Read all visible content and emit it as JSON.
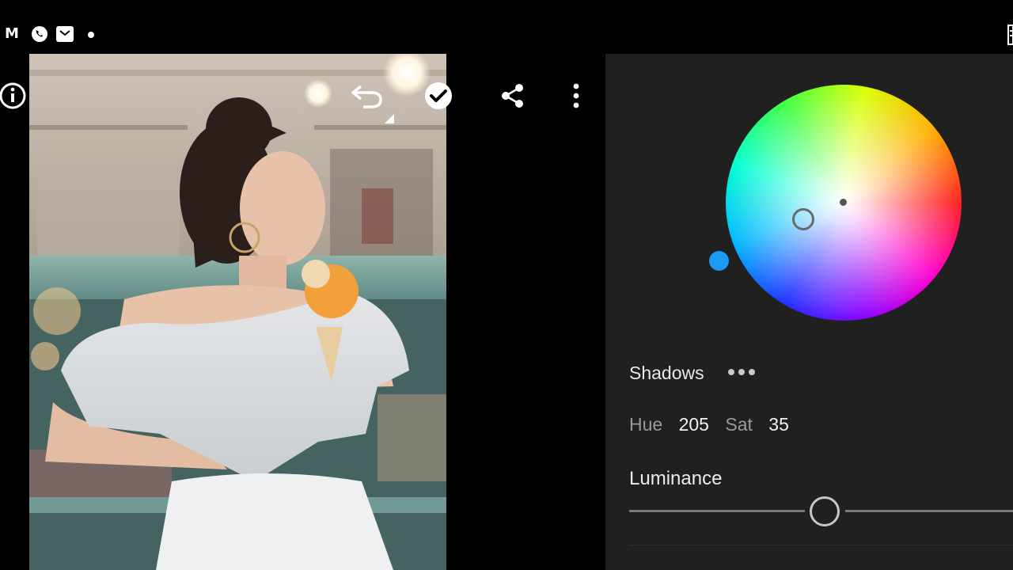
{
  "status_bar": {
    "app_letter": "M",
    "icons": [
      "whatsapp-icon",
      "mail-icon",
      "notification-dot-icon"
    ]
  },
  "toolbar": {
    "icons": [
      "info-icon",
      "undo-icon",
      "done-icon",
      "share-icon",
      "more-options-icon"
    ]
  },
  "photo": {
    "subject": "woman-holding-ice-cream-cone"
  },
  "color_grading": {
    "region_label": "Shadows",
    "hue_label": "Hue",
    "hue_value": "205",
    "sat_label": "Sat",
    "sat_value": "35",
    "luminance_label": "Luminance",
    "luminance_level": 0.5,
    "knob_color": "#1b9cf2"
  },
  "colors": {
    "background": "#000000",
    "panel": "#202020",
    "accent": "#1b9cf2"
  }
}
